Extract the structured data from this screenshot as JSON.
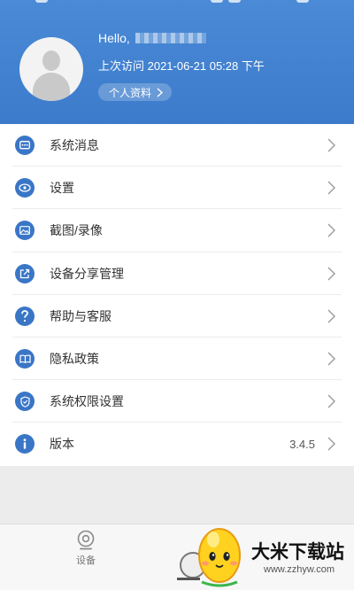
{
  "header": {
    "greeting": "Hello,",
    "last_visit": "上次访问 2021-06-21 05:28 下午",
    "profile_button": "个人资料"
  },
  "menu": {
    "items": [
      {
        "label": "系统消息",
        "icon": "message-icon"
      },
      {
        "label": "设置",
        "icon": "eye-icon"
      },
      {
        "label": "截图/录像",
        "icon": "image-icon"
      },
      {
        "label": "设备分享管理",
        "icon": "share-icon"
      },
      {
        "label": "帮助与客服",
        "icon": "help-icon"
      },
      {
        "label": "隐私政策",
        "icon": "book-icon"
      },
      {
        "label": "系统权限设置",
        "icon": "shield-icon"
      },
      {
        "label": "版本",
        "icon": "info-icon",
        "value": "3.4.5"
      }
    ]
  },
  "bottom_nav": {
    "tabs": [
      {
        "label": "设备",
        "icon": "camera-icon"
      }
    ]
  },
  "watermark": {
    "text": "大米下载站",
    "url": "www.zzhyw.com"
  },
  "colors": {
    "header_blue": "#3c7bcb",
    "icon_blue": "#3a76c6"
  }
}
